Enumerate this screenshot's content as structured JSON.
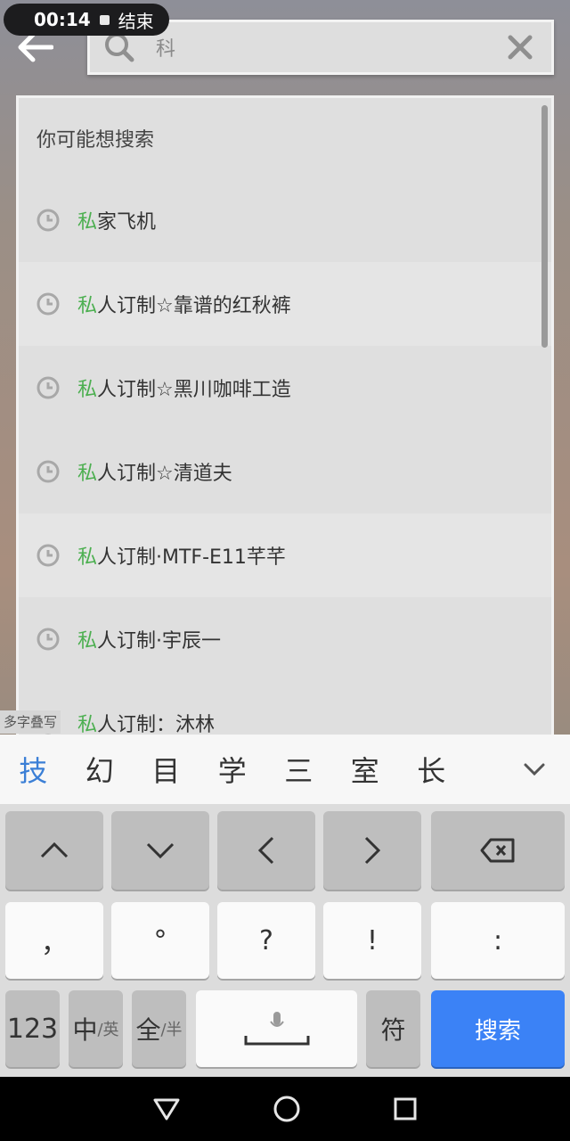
{
  "recorder": {
    "time": "00:14",
    "end_label": "结束"
  },
  "search": {
    "query": "科"
  },
  "suggestions": {
    "header": "你可能想搜索",
    "items": [
      {
        "highlight": "私",
        "rest": "家飞机"
      },
      {
        "highlight": "私",
        "rest": "人订制☆靠谱的红秋裤"
      },
      {
        "highlight": "私",
        "rest": "人订制☆黑川咖啡工造"
      },
      {
        "highlight": "私",
        "rest": "人订制☆清道夫"
      },
      {
        "highlight": "私",
        "rest": "人订制·MTF-E11芊芊"
      },
      {
        "highlight": "私",
        "rest": "人订制·宇辰一"
      },
      {
        "highlight": "私",
        "rest": "人订制：沐林"
      }
    ]
  },
  "ime": {
    "handwrite_tag": "多字叠写",
    "candidates": [
      "技",
      "幻",
      "目",
      "学",
      "三",
      "室",
      "长"
    ]
  },
  "keyboard": {
    "row2": [
      "，",
      "°",
      "?",
      "!",
      ":"
    ],
    "num_label": "123",
    "lang_main": "中",
    "lang_sub": "/英",
    "width_main": "全",
    "width_sub": "/半",
    "symbol_label": "符",
    "search_label": "搜索"
  },
  "colors": {
    "highlight": "#4caf50",
    "accent": "#3b82f6"
  }
}
